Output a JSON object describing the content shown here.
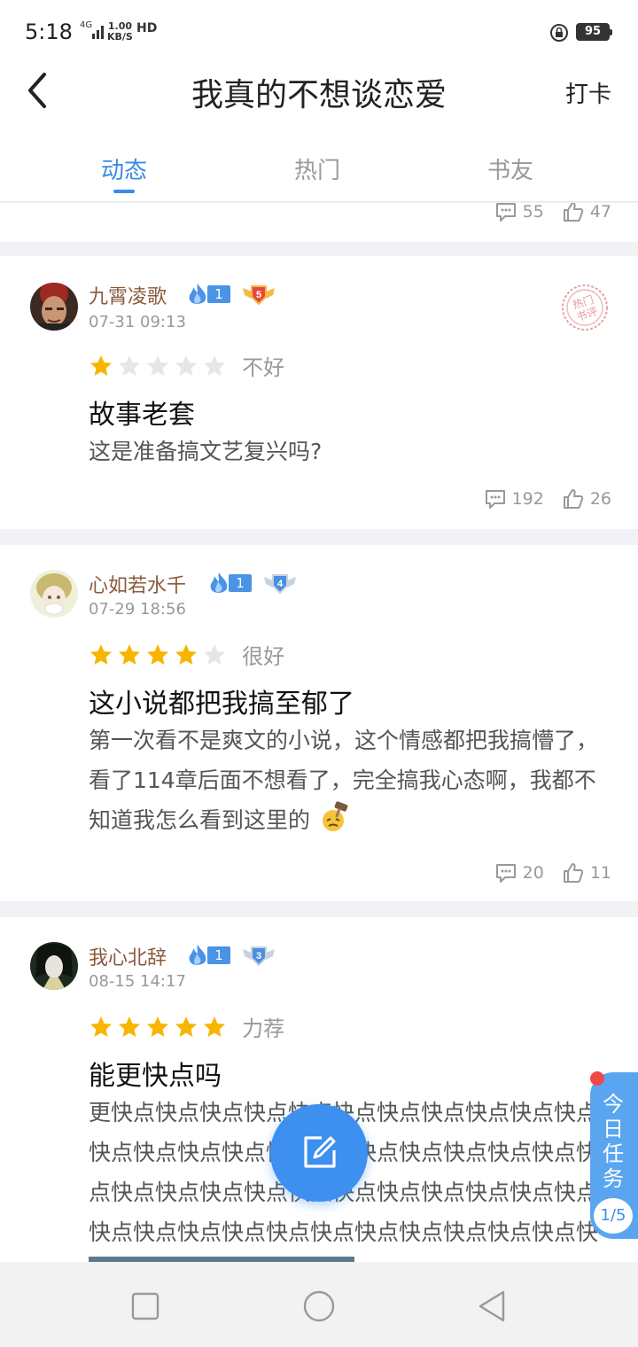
{
  "status_bar": {
    "time": "5:18",
    "network": "4G",
    "speed_value": "1.00",
    "speed_unit": "KB/S",
    "hd": "HD",
    "battery": "95"
  },
  "header": {
    "title": "我真的不想谈恋爱",
    "action_label": "打卡"
  },
  "tabs": [
    {
      "label": "动态",
      "active": true
    },
    {
      "label": "热门",
      "active": false
    },
    {
      "label": "书友",
      "active": false
    }
  ],
  "partial_post": {
    "comments": "55",
    "likes": "47"
  },
  "posts": [
    {
      "username": "九霄凌歌",
      "fan_level": "1",
      "user_level": "5",
      "timestamp": "07-31 09:13",
      "rating": 1,
      "rating_label": "不好",
      "title": "故事老套",
      "body": "这是准备搞文艺复兴吗?",
      "comments": "192",
      "likes": "26",
      "hot_stamp": "热门\n书评"
    },
    {
      "username": "心如若水千",
      "fan_level": "1",
      "user_level": "4",
      "timestamp": "07-29 18:56",
      "rating": 4,
      "rating_label": "很好",
      "title": "这小说都把我搞至郁了",
      "body": "第一次看不是爽文的小说，这个情感都把我搞懵了，看了114章后面不想看了，完全搞我心态啊，我都不知道我怎么看到这里的",
      "comments": "20",
      "likes": "11"
    },
    {
      "username": "我心北辞",
      "fan_level": "1",
      "user_level": "3",
      "timestamp": "08-15 14:17",
      "rating": 5,
      "rating_label": "力荐",
      "title": "能更快点吗",
      "body": "更快点快点快点快点快点快点快点快点快点快点快点快点快点快点快点快点快点快点快点快点快点快点快点快点快点快点快点快点快点快点快点快点快点快点快点快点快点快点快点快点快点快点快点快点快点快点快点快点快点快点快点快点..."
    }
  ],
  "task_widget": {
    "label": "今日任务",
    "count": "1/5"
  },
  "colors": {
    "accent": "#3a8be6",
    "star_on": "#f7b500",
    "star_off": "#e6e6e6",
    "username": "#8a5a3c"
  }
}
